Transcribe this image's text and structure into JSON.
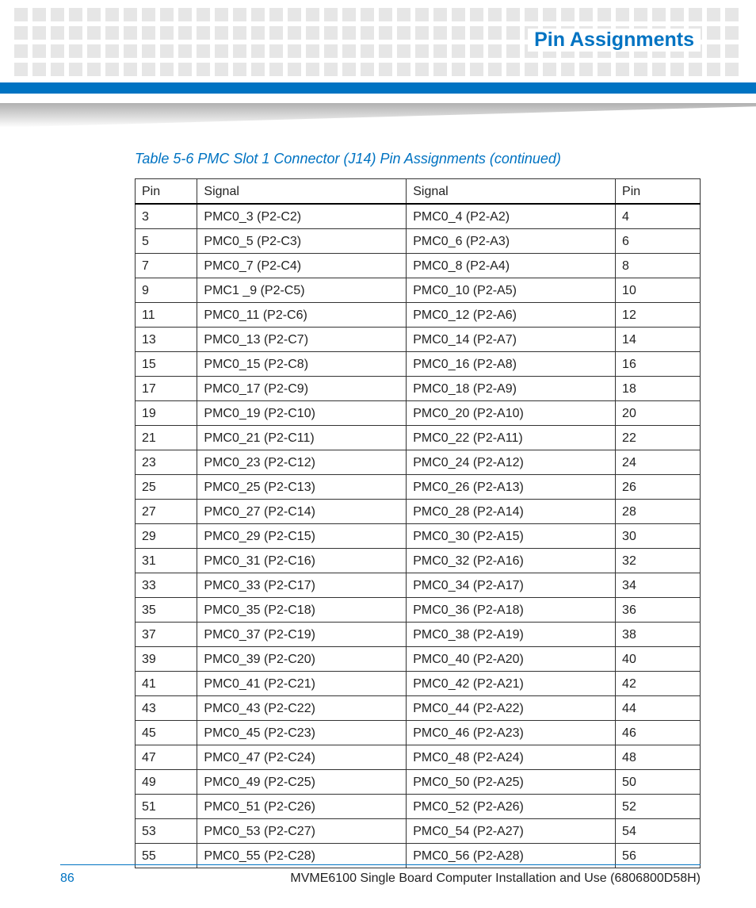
{
  "header": {
    "title": "Pin Assignments"
  },
  "table": {
    "caption": "Table 5-6 PMC Slot 1 Connector (J14) Pin Assignments (continued)",
    "headers": [
      "Pin",
      "Signal",
      "Signal",
      "Pin"
    ],
    "rows": [
      [
        "3",
        "PMC0_3 (P2-C2)",
        "PMC0_4 (P2-A2)",
        "4"
      ],
      [
        "5",
        "PMC0_5 (P2-C3)",
        "PMC0_6 (P2-A3)",
        "6"
      ],
      [
        "7",
        "PMC0_7 (P2-C4)",
        "PMC0_8 (P2-A4)",
        "8"
      ],
      [
        "9",
        "PMC1 _9 (P2-C5)",
        "PMC0_10 (P2-A5)",
        "10"
      ],
      [
        "11",
        "PMC0_11 (P2-C6)",
        "PMC0_12 (P2-A6)",
        "12"
      ],
      [
        "13",
        "PMC0_13 (P2-C7)",
        "PMC0_14 (P2-A7)",
        "14"
      ],
      [
        "15",
        "PMC0_15 (P2-C8)",
        "PMC0_16 (P2-A8)",
        "16"
      ],
      [
        "17",
        "PMC0_17 (P2-C9)",
        "PMC0_18 (P2-A9)",
        "18"
      ],
      [
        "19",
        "PMC0_19 (P2-C10)",
        "PMC0_20 (P2-A10)",
        "20"
      ],
      [
        "21",
        "PMC0_21 (P2-C11)",
        "PMC0_22 (P2-A11)",
        "22"
      ],
      [
        "23",
        "PMC0_23 (P2-C12)",
        "PMC0_24 (P2-A12)",
        "24"
      ],
      [
        "25",
        "PMC0_25 (P2-C13)",
        "PMC0_26 (P2-A13)",
        "26"
      ],
      [
        "27",
        "PMC0_27 (P2-C14)",
        "PMC0_28 (P2-A14)",
        "28"
      ],
      [
        "29",
        "PMC0_29 (P2-C15)",
        "PMC0_30 (P2-A15)",
        "30"
      ],
      [
        "31",
        "PMC0_31 (P2-C16)",
        "PMC0_32 (P2-A16)",
        "32"
      ],
      [
        "33",
        "PMC0_33 (P2-C17)",
        "PMC0_34 (P2-A17)",
        "34"
      ],
      [
        "35",
        "PMC0_35 (P2-C18)",
        "PMC0_36 (P2-A18)",
        "36"
      ],
      [
        "37",
        "PMC0_37 (P2-C19)",
        "PMC0_38 (P2-A19)",
        "38"
      ],
      [
        "39",
        "PMC0_39 (P2-C20)",
        "PMC0_40 (P2-A20)",
        "40"
      ],
      [
        "41",
        "PMC0_41 (P2-C21)",
        "PMC0_42 (P2-A21)",
        "42"
      ],
      [
        "43",
        "PMC0_43 (P2-C22)",
        "PMC0_44 (P2-A22)",
        "44"
      ],
      [
        "45",
        "PMC0_45 (P2-C23)",
        "PMC0_46 (P2-A23)",
        "46"
      ],
      [
        "47",
        "PMC0_47 (P2-C24)",
        "PMC0_48 (P2-A24)",
        "48"
      ],
      [
        "49",
        "PMC0_49 (P2-C25)",
        "PMC0_50 (P2-A25)",
        "50"
      ],
      [
        "51",
        "PMC0_51 (P2-C26)",
        "PMC0_52 (P2-A26)",
        "52"
      ],
      [
        "53",
        "PMC0_53 (P2-C27)",
        "PMC0_54 (P2-A27)",
        "54"
      ],
      [
        "55",
        "PMC0_55 (P2-C28)",
        "PMC0_56 (P2-A28)",
        "56"
      ]
    ]
  },
  "footer": {
    "page": "86",
    "doc": "MVME6100 Single Board Computer Installation and Use (6806800D58H)"
  }
}
